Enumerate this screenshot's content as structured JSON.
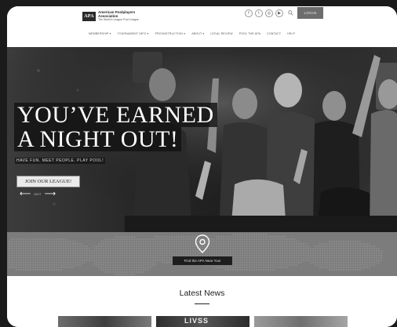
{
  "logo": {
    "badge": "APA",
    "line1": "American Poolplayers",
    "line2": "Association",
    "tagline": "The World's League Pool League"
  },
  "header": {
    "socials": [
      "f",
      "t",
      "◎",
      "▶"
    ],
    "login_label": "LOGIN"
  },
  "nav": {
    "items": [
      "MEMBERSHIP ▾",
      "TOURNAMENT INFO ▾",
      "PRO/INSTRUCTION ▾",
      "ABOUT ▾",
      "LEGAL REVIEW",
      "POOL THE APA",
      "CONTACT",
      "HELP"
    ]
  },
  "hero": {
    "title_line1": "YOU’VE EARNED",
    "title_line2": "A NIGHT OUT!",
    "subtitle": "HAVE FUN. MEET PEOPLE. PLAY POOL!",
    "cta_label": "JOIN OUR LEAGUE!",
    "slider_label": "NEXT"
  },
  "map": {
    "button_label": "Find the APA Near You!"
  },
  "news": {
    "title": "Latest News",
    "thumb2_text": "LIVSS"
  }
}
